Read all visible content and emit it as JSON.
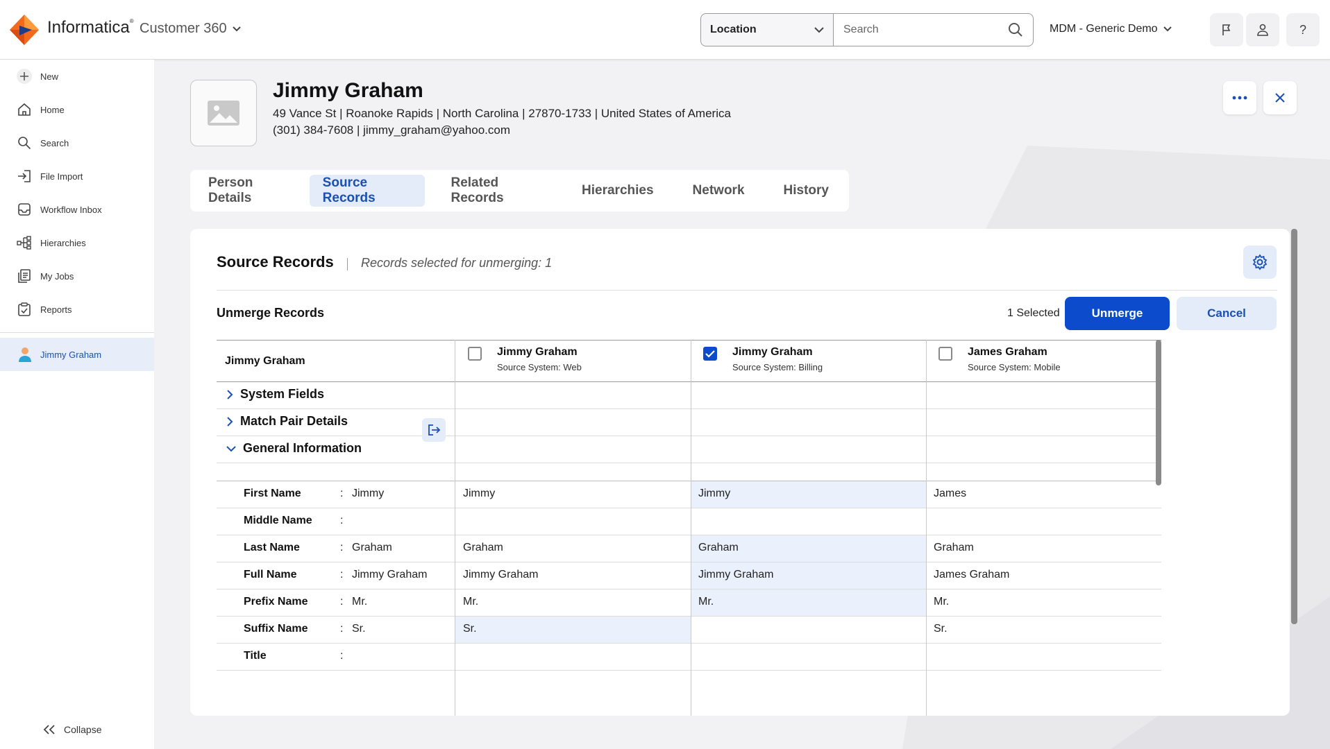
{
  "app": {
    "brand": "Informatica",
    "product": "Customer 360",
    "location_label": "Location",
    "search_placeholder": "Search",
    "tenant": "MDM - Generic Demo"
  },
  "sidebar": {
    "items": [
      {
        "label": "New",
        "icon": "plus-icon"
      },
      {
        "label": "Home",
        "icon": "home-icon"
      },
      {
        "label": "Search",
        "icon": "search-icon"
      },
      {
        "label": "File Import",
        "icon": "file-import-icon"
      },
      {
        "label": "Workflow Inbox",
        "icon": "inbox-icon"
      },
      {
        "label": "Hierarchies",
        "icon": "hierarchy-icon"
      },
      {
        "label": "My Jobs",
        "icon": "jobs-icon"
      },
      {
        "label": "Reports",
        "icon": "reports-icon"
      }
    ],
    "active_record": "Jimmy Graham",
    "collapse_label": "Collapse"
  },
  "person": {
    "name": "Jimmy Graham",
    "address": "49 Vance St | Roanoke Rapids | North Carolina | 27870-1733 | United States of America",
    "contact": "(301) 384-7608 | jimmy_graham@yahoo.com"
  },
  "tabs": [
    "Person Details",
    "Source Records",
    "Related Records",
    "Hierarchies",
    "Network",
    "History"
  ],
  "active_tab": "Source Records",
  "panel": {
    "title": "Source Records",
    "subtitle": "Records selected for unmerging: 1",
    "unmerge_label": "Unmerge Records",
    "selected_count": "1 Selected",
    "unmerge_button": "Unmerge",
    "cancel_button": "Cancel"
  },
  "grid": {
    "master_name": "Jimmy Graham",
    "columns": [
      {
        "name": "Jimmy Graham",
        "source": "Source System:  Web",
        "checked": false
      },
      {
        "name": "Jimmy Graham",
        "source": "Source System:  Billing",
        "checked": true
      },
      {
        "name": "James Graham",
        "source": "Source System:  Mobile",
        "checked": false
      }
    ],
    "sections": {
      "system_fields": "System Fields",
      "match_pair": "Match Pair Details",
      "general": "General Information"
    },
    "rows": [
      {
        "label": "First Name",
        "master": "Jimmy",
        "values": [
          "Jimmy",
          "Jimmy",
          "James"
        ],
        "highlight": [
          false,
          true,
          false
        ]
      },
      {
        "label": "Middle Name",
        "master": "",
        "values": [
          "",
          "",
          ""
        ],
        "highlight": [
          false,
          false,
          false
        ]
      },
      {
        "label": "Last Name",
        "master": "Graham",
        "values": [
          "Graham",
          "Graham",
          "Graham"
        ],
        "highlight": [
          false,
          true,
          false
        ]
      },
      {
        "label": "Full Name",
        "master": "Jimmy Graham",
        "values": [
          "Jimmy Graham",
          "Jimmy Graham",
          "James Graham"
        ],
        "highlight": [
          false,
          true,
          false
        ]
      },
      {
        "label": "Prefix Name",
        "master": "Mr.",
        "values": [
          "Mr.",
          "Mr.",
          "Mr."
        ],
        "highlight": [
          false,
          true,
          false
        ]
      },
      {
        "label": "Suffix Name",
        "master": "Sr.",
        "values": [
          "Sr.",
          "",
          "Sr."
        ],
        "highlight": [
          true,
          false,
          false
        ]
      },
      {
        "label": "Title",
        "master": "",
        "values": [
          "",
          "",
          ""
        ],
        "highlight": [
          false,
          false,
          false
        ]
      }
    ]
  },
  "colors": {
    "accent": "#0c4ccc",
    "highlight": "#ebf1fc",
    "logo_orange": "#f26b1d"
  }
}
